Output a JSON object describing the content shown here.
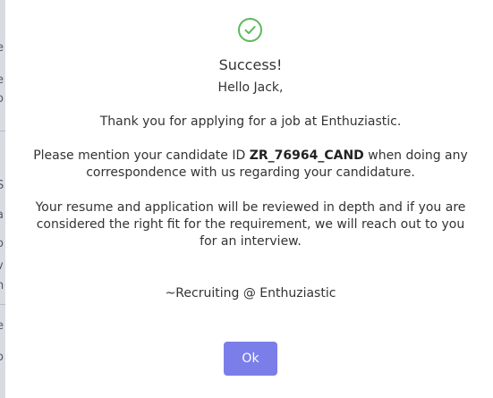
{
  "background_fragments": [
    "e",
    "e",
    "o",
    "S",
    "a",
    "o",
    "v",
    "n",
    "e",
    "o"
  ],
  "modal": {
    "title": "Success!",
    "greeting": "Hello Jack,",
    "thanks": "Thank you for applying for a job at Enthuziastic.",
    "candidate_prefix": "Please mention your candidate ID",
    "candidate_id": "ZR_76964_CAND",
    "candidate_suffix": "when doing any correspondence with us regarding your candidature.",
    "review": "Your resume and application will be reviewed in depth and if you are considered the right fit for the requirement, we will reach out to you for an interview.",
    "signature": "~Recruiting @ Enthuziastic",
    "ok_label": "Ok"
  },
  "colors": {
    "success_green": "#5cb85c",
    "button_purple": "#7b7ee8"
  },
  "icons": {
    "success": "check-circle-icon"
  }
}
